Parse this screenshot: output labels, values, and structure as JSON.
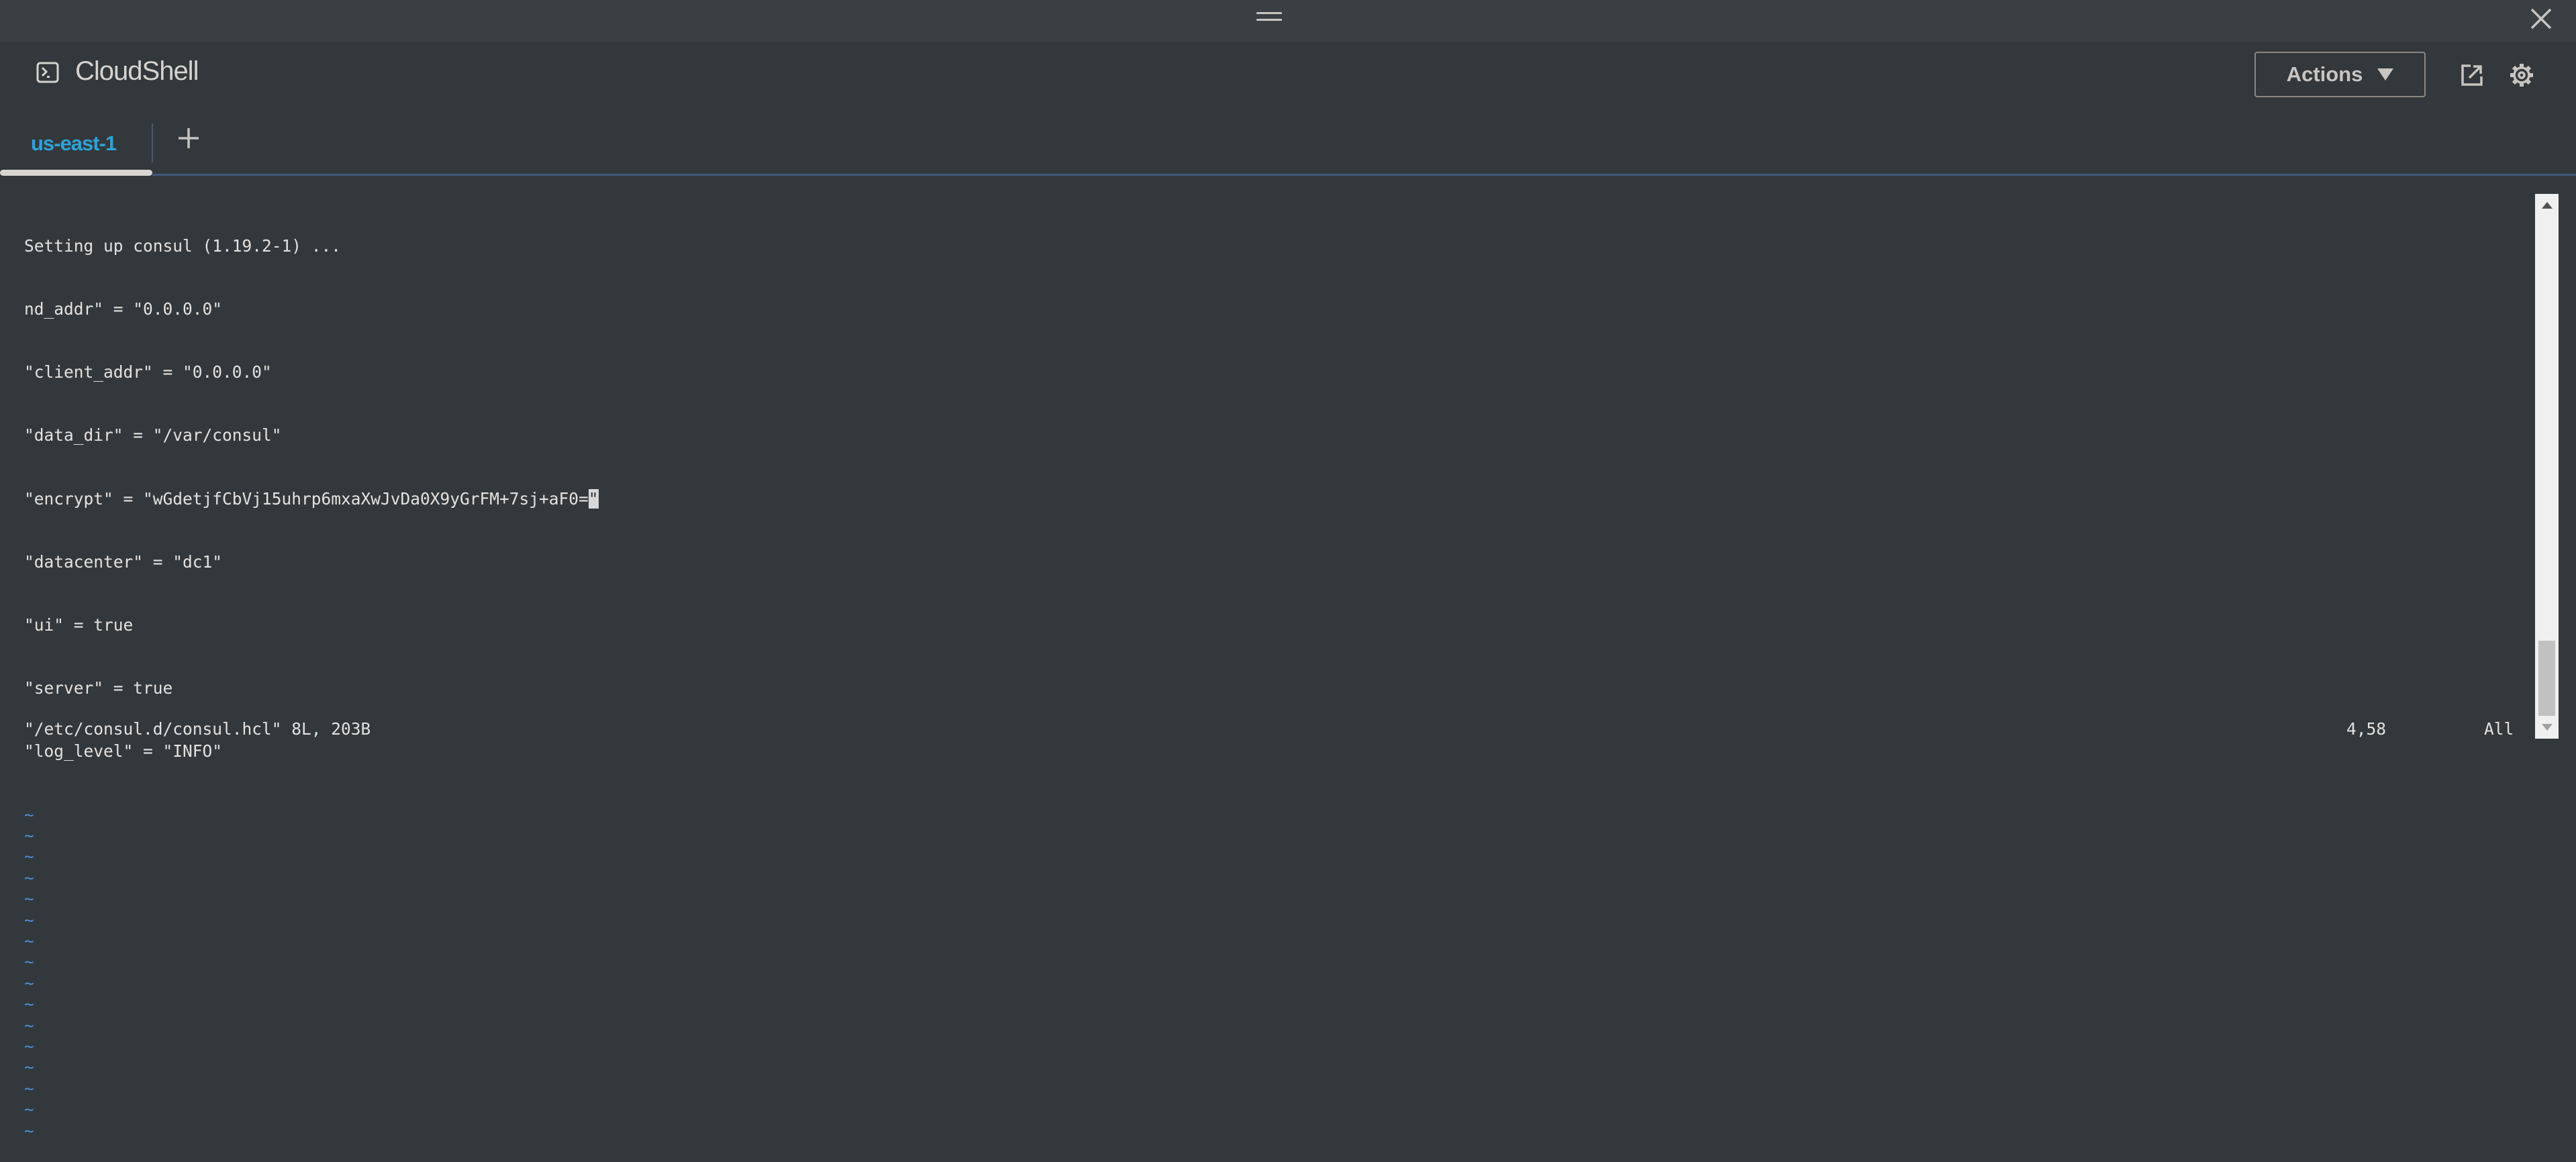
{
  "window": {
    "drag_icon": "drag-handle-icon",
    "close_icon": "close-icon"
  },
  "header": {
    "title": "CloudShell",
    "logo_icon": "terminal-icon",
    "actions_label": "Actions",
    "popout_icon": "external-link-icon",
    "settings_icon": "gear-icon"
  },
  "tabs": [
    {
      "label": "us-east-1",
      "active": true
    }
  ],
  "new_tab_icon": "plus-icon",
  "colors": {
    "accent": "#2ea3d8",
    "background": "#33383c",
    "tilde": "#4a8fd8"
  },
  "terminal": {
    "lines": [
      "Setting up consul (1.19.2-1) ...",
      "nd_addr\" = \"0.0.0.0\"",
      "\"client_addr\" = \"0.0.0.0\"",
      "\"data_dir\" = \"/var/consul\"",
      "\"encrypt\" = \"wGdetjfCbVj15uhrp6mxaXwJvDa0X9yGrFM+7sj+aF0=",
      "\"datacenter\" = \"dc1\"",
      "\"ui\" = true",
      "\"server\" = true",
      "\"log_level\" = \"INFO\""
    ],
    "cursor_char": "\"",
    "tilde": "~",
    "status_file": "\"/etc/consul.d/consul.hcl\" 8L, 203B",
    "status_position": "4,58",
    "status_scroll": "All"
  },
  "scrollbar": {
    "position_fraction": 1.0
  }
}
